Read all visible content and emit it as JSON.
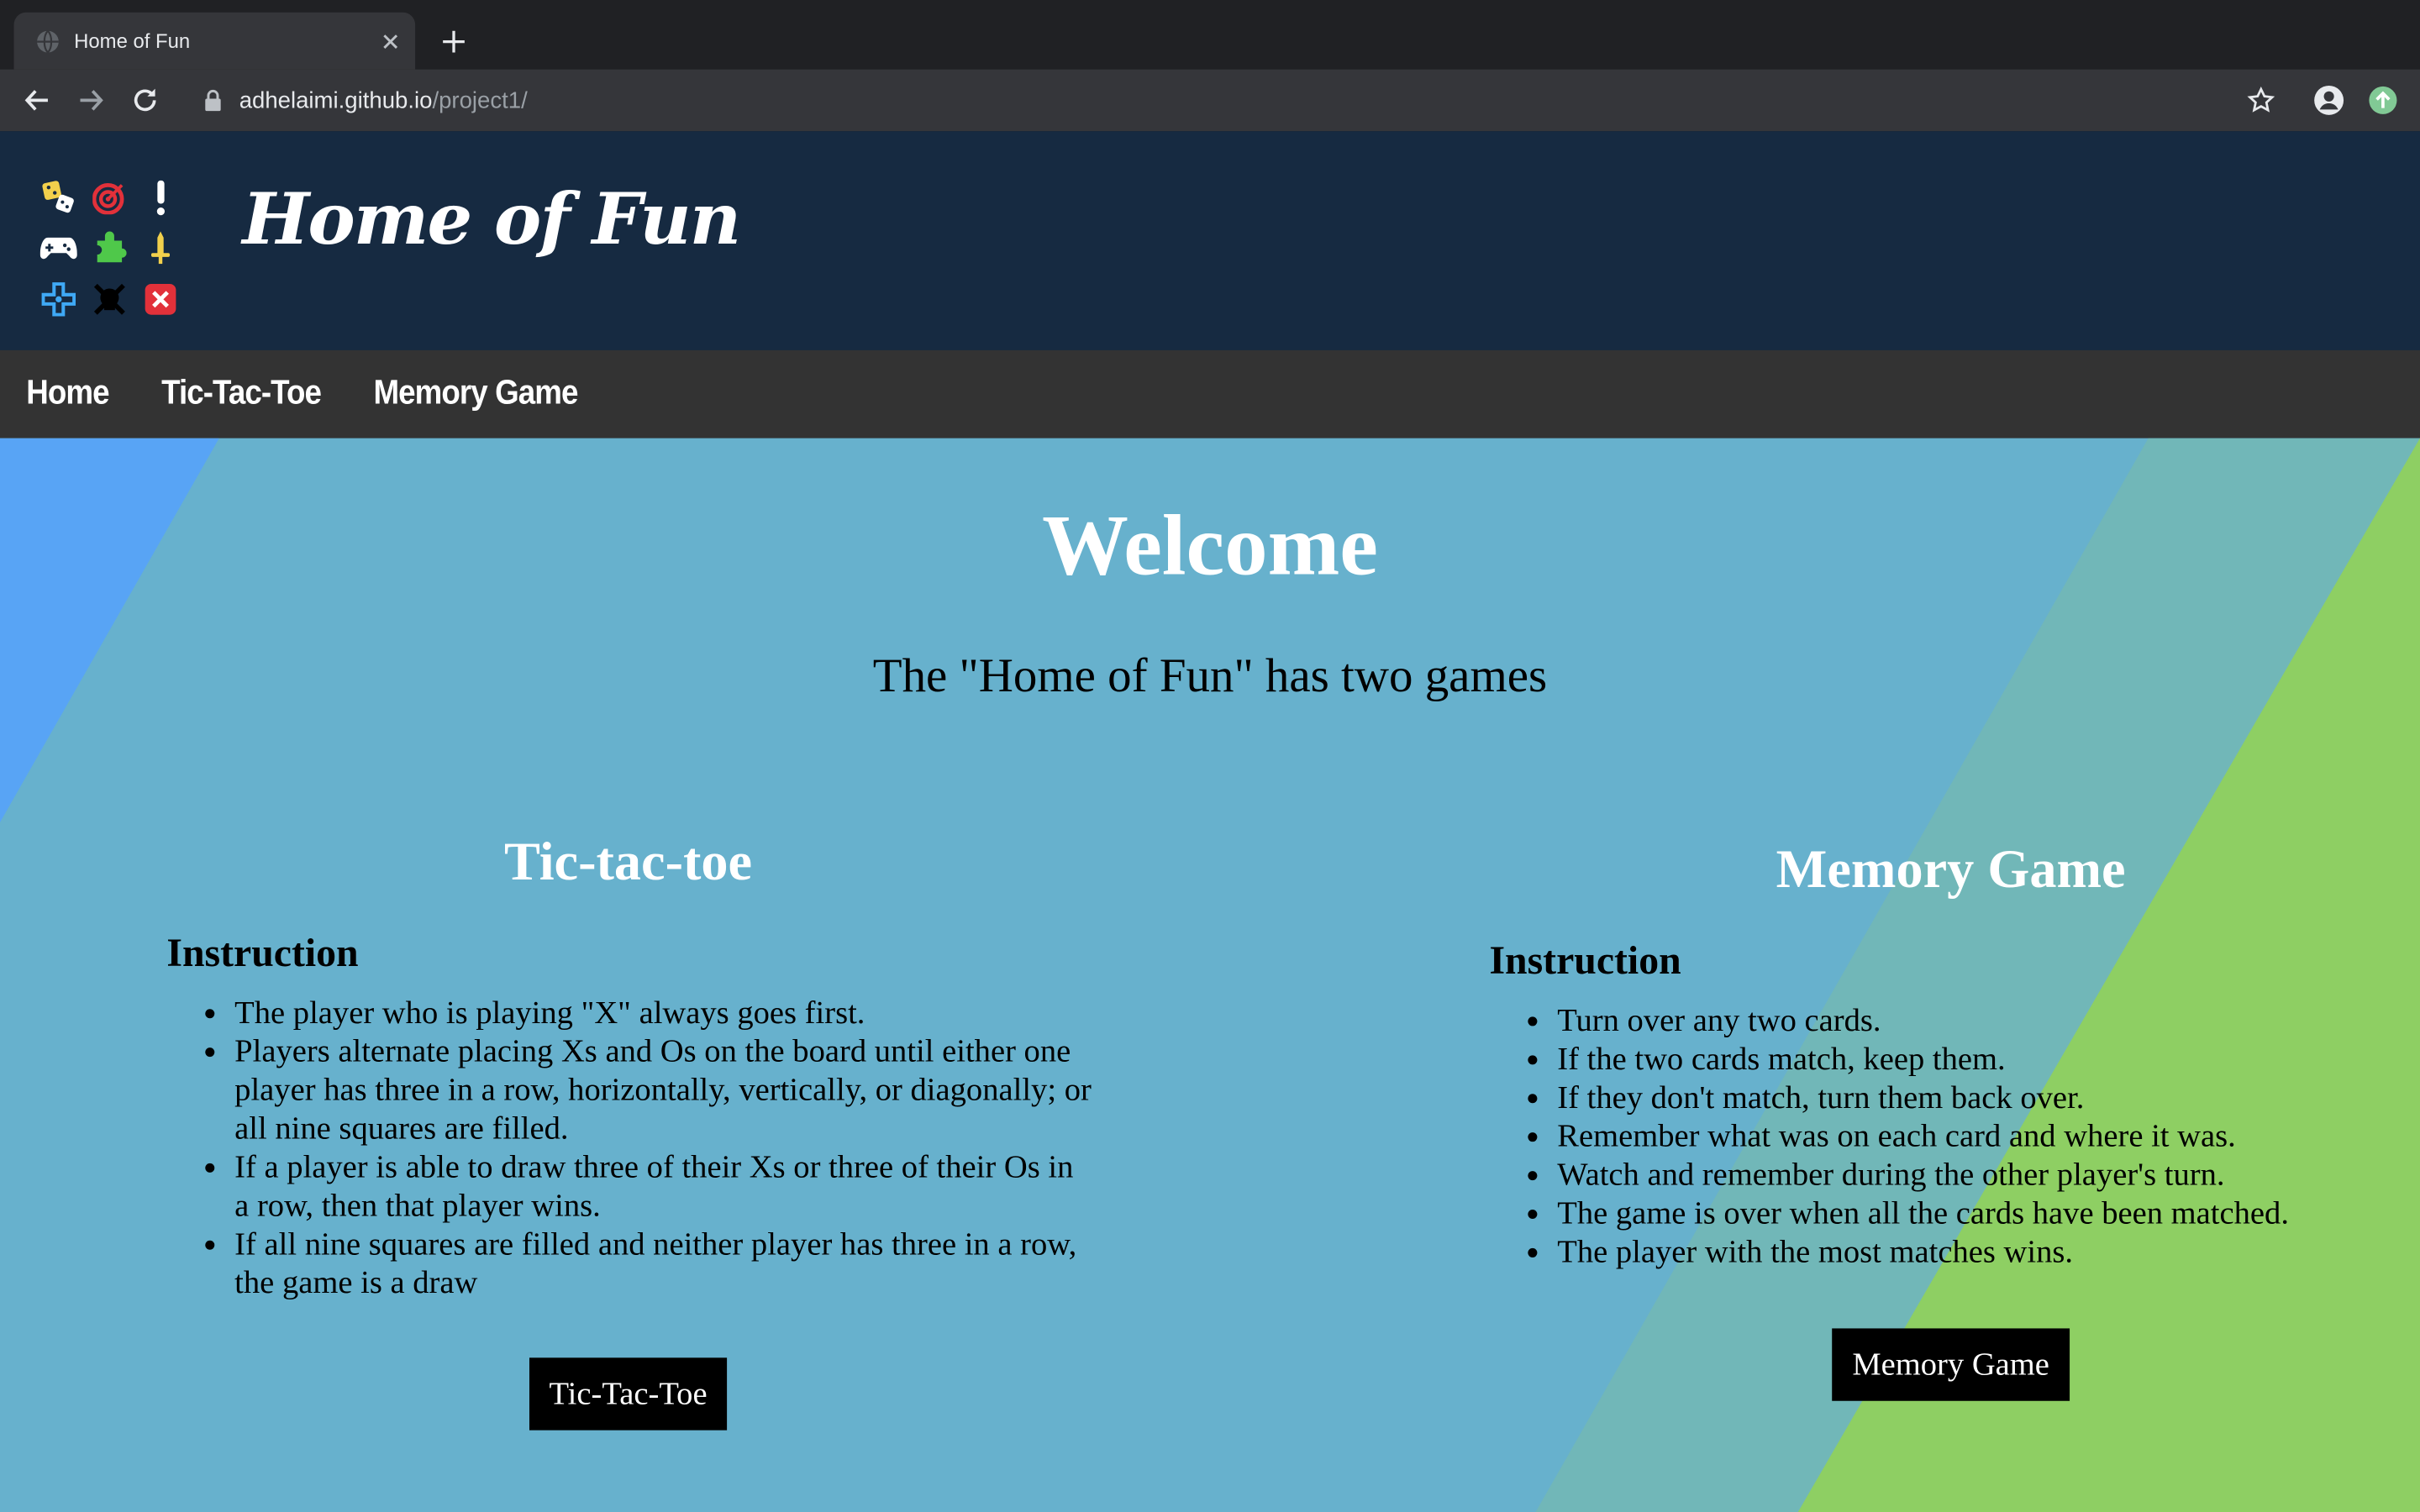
{
  "browser": {
    "tab_title": "Home of Fun",
    "url_domain": "adhelaimi.github.io",
    "url_path": "/project1/"
  },
  "header": {
    "site_title": "Home of Fun",
    "logo_icons": [
      "dice-icon",
      "target-icon",
      "exclamation-icon",
      "gamepad-icon",
      "puzzle-icon",
      "sword-icon",
      "dpad-icon",
      "skull-crossbones-icon",
      "x-square-icon"
    ]
  },
  "nav": {
    "items": [
      "Home",
      "Tic-Tac-Toe",
      "Memory Game"
    ]
  },
  "main": {
    "welcome": "Welcome",
    "subtitle": "The \"Home of Fun\" has two games",
    "games": [
      {
        "title": "Tic-tac-toe",
        "instruction_heading": "Instruction",
        "rules": [
          "The player who is playing \"X\" always goes first.",
          "Players alternate placing Xs and Os on the board until either one player has three in a row, horizontally, vertically, or diagonally; or all nine squares are filled.",
          "If a player is able to draw three of their Xs or three of their Os in a row, then that player wins.",
          "If all nine squares are filled and neither player has three in a row, the game is a draw"
        ],
        "button_label": "Tic-Tac-Toe"
      },
      {
        "title": "Memory Game",
        "instruction_heading": "Instruction",
        "rules": [
          "Turn over any two cards.",
          "If the two cards match, keep them.",
          "If they don't match, turn them back over.",
          "Remember what was on each card and where it was.",
          "Watch and remember during the other player's turn.",
          "The game is over when all the cards have been matched.",
          "The player with the most matches wins."
        ],
        "button_label": "Memory Game"
      }
    ]
  },
  "colors": {
    "header_bg": "#162a41",
    "nav_bg": "#333333",
    "content_bg": "#67b1cd",
    "accent_green": "#8ecf63",
    "accent_blue": "#57a4f4"
  }
}
